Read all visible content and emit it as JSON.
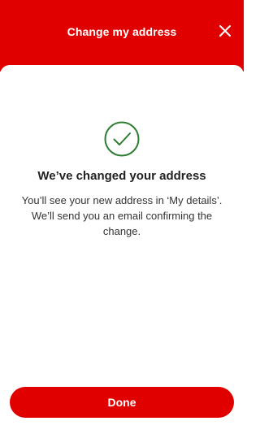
{
  "header": {
    "title": "Change my address",
    "close_icon": "close-icon"
  },
  "confirmation": {
    "icon": "check-circle-icon",
    "title": "We’ve changed your address",
    "body": "You’ll see your new address in ‘My details’. We’ll send you an email confirming the change."
  },
  "actions": {
    "done_label": "Done"
  },
  "colors": {
    "brand_red": "#e00000",
    "success_green": "#2e7d32",
    "text_primary": "#222222"
  }
}
